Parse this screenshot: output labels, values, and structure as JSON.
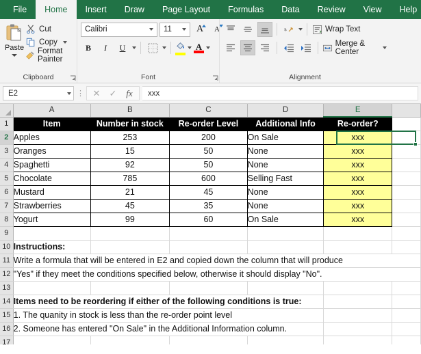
{
  "ribbon": {
    "tabs": [
      {
        "label": "File",
        "active": false
      },
      {
        "label": "Home",
        "active": true
      },
      {
        "label": "Insert",
        "active": false
      },
      {
        "label": "Draw",
        "active": false
      },
      {
        "label": "Page Layout",
        "active": false
      },
      {
        "label": "Formulas",
        "active": false
      },
      {
        "label": "Data",
        "active": false
      },
      {
        "label": "Review",
        "active": false
      },
      {
        "label": "View",
        "active": false
      },
      {
        "label": "Help",
        "active": false
      }
    ],
    "clipboard": {
      "group_label": "Clipboard",
      "paste_label": "Paste",
      "paste_icon": "paste-icon",
      "cut_label": "Cut",
      "cut_icon": "scissors-icon",
      "copy_label": "Copy",
      "copy_icon": "copy-icon",
      "format_painter_label": "Format Painter",
      "format_painter_icon": "paintbrush-icon"
    },
    "font": {
      "group_label": "Font",
      "font_name": "Calibri",
      "font_size": "11",
      "grow_font_icon": "grow-font-icon",
      "shrink_font_icon": "shrink-font-icon",
      "bold_label": "B",
      "italic_label": "I",
      "underline_label": "U",
      "borders_icon": "borders-icon",
      "fill_color_icon": "fill-color-icon",
      "fill_color": "#ffff00",
      "font_color_icon": "font-color-icon",
      "font_color": "#ff0000"
    },
    "alignment": {
      "group_label": "Alignment",
      "top_align_icon": "align-top-icon",
      "middle_align_icon": "align-middle-icon",
      "bottom_align_icon": "align-bottom-icon",
      "orientation_icon": "orientation-icon",
      "align_left_icon": "align-left-icon",
      "align_center_icon": "align-center-icon",
      "align_right_icon": "align-right-icon",
      "decrease_indent_icon": "decrease-indent-icon",
      "increase_indent_icon": "increase-indent-icon",
      "wrap_text_label": "Wrap Text",
      "wrap_text_icon": "wrap-text-icon",
      "merge_center_label": "Merge & Center",
      "merge_center_icon": "merge-cells-icon"
    }
  },
  "formula_bar": {
    "name_box": "E2",
    "cancel_icon": "cancel-icon",
    "enter_icon": "checkmark-icon",
    "function_icon": "fx-icon",
    "content": "xxx"
  },
  "sheet": {
    "columns": [
      "A",
      "B",
      "C",
      "D",
      "E"
    ],
    "selected_column": "E",
    "selected_cell": "E2",
    "row_numbers": [
      "1",
      "2",
      "3",
      "4",
      "5",
      "6",
      "7",
      "8",
      "9",
      "10",
      "11",
      "12",
      "13",
      "14",
      "15",
      "16",
      "17"
    ],
    "headers": [
      "Item",
      "Number in stock",
      "Re-order Level",
      "Additional Info",
      "Re-order?"
    ],
    "rows": [
      {
        "item": "Apples",
        "stock": "253",
        "reorder": "200",
        "info": "On Sale",
        "flag": "xxx"
      },
      {
        "item": "Oranges",
        "stock": "15",
        "reorder": "50",
        "info": "None",
        "flag": "xxx"
      },
      {
        "item": "Spaghetti",
        "stock": "92",
        "reorder": "50",
        "info": "None",
        "flag": "xxx"
      },
      {
        "item": "Chocolate",
        "stock": "785",
        "reorder": "600",
        "info": "Selling Fast",
        "flag": "xxx"
      },
      {
        "item": "Mustard",
        "stock": "21",
        "reorder": "45",
        "info": "None",
        "flag": "xxx"
      },
      {
        "item": "Strawberries",
        "stock": "45",
        "reorder": "35",
        "info": "None",
        "flag": "xxx"
      },
      {
        "item": "Yogurt",
        "stock": "99",
        "reorder": "60",
        "info": "On Sale",
        "flag": "xxx"
      }
    ],
    "notes": {
      "instructions_title": "Instructions:",
      "instructions_line1": "Write a formula that will be entered in E2 and copied down the column that will produce",
      "instructions_line2": "\"Yes\" if they meet the conditions specified below, otherwise it should display \"No\".",
      "conditions_title": "Items need to be reordering if either of the following conditions is true:",
      "condition1": "1.  The quanity in stock is less than the re-order point level",
      "condition2": "2.  Someone has entered \"On Sale\" in the Additional Information column."
    }
  }
}
